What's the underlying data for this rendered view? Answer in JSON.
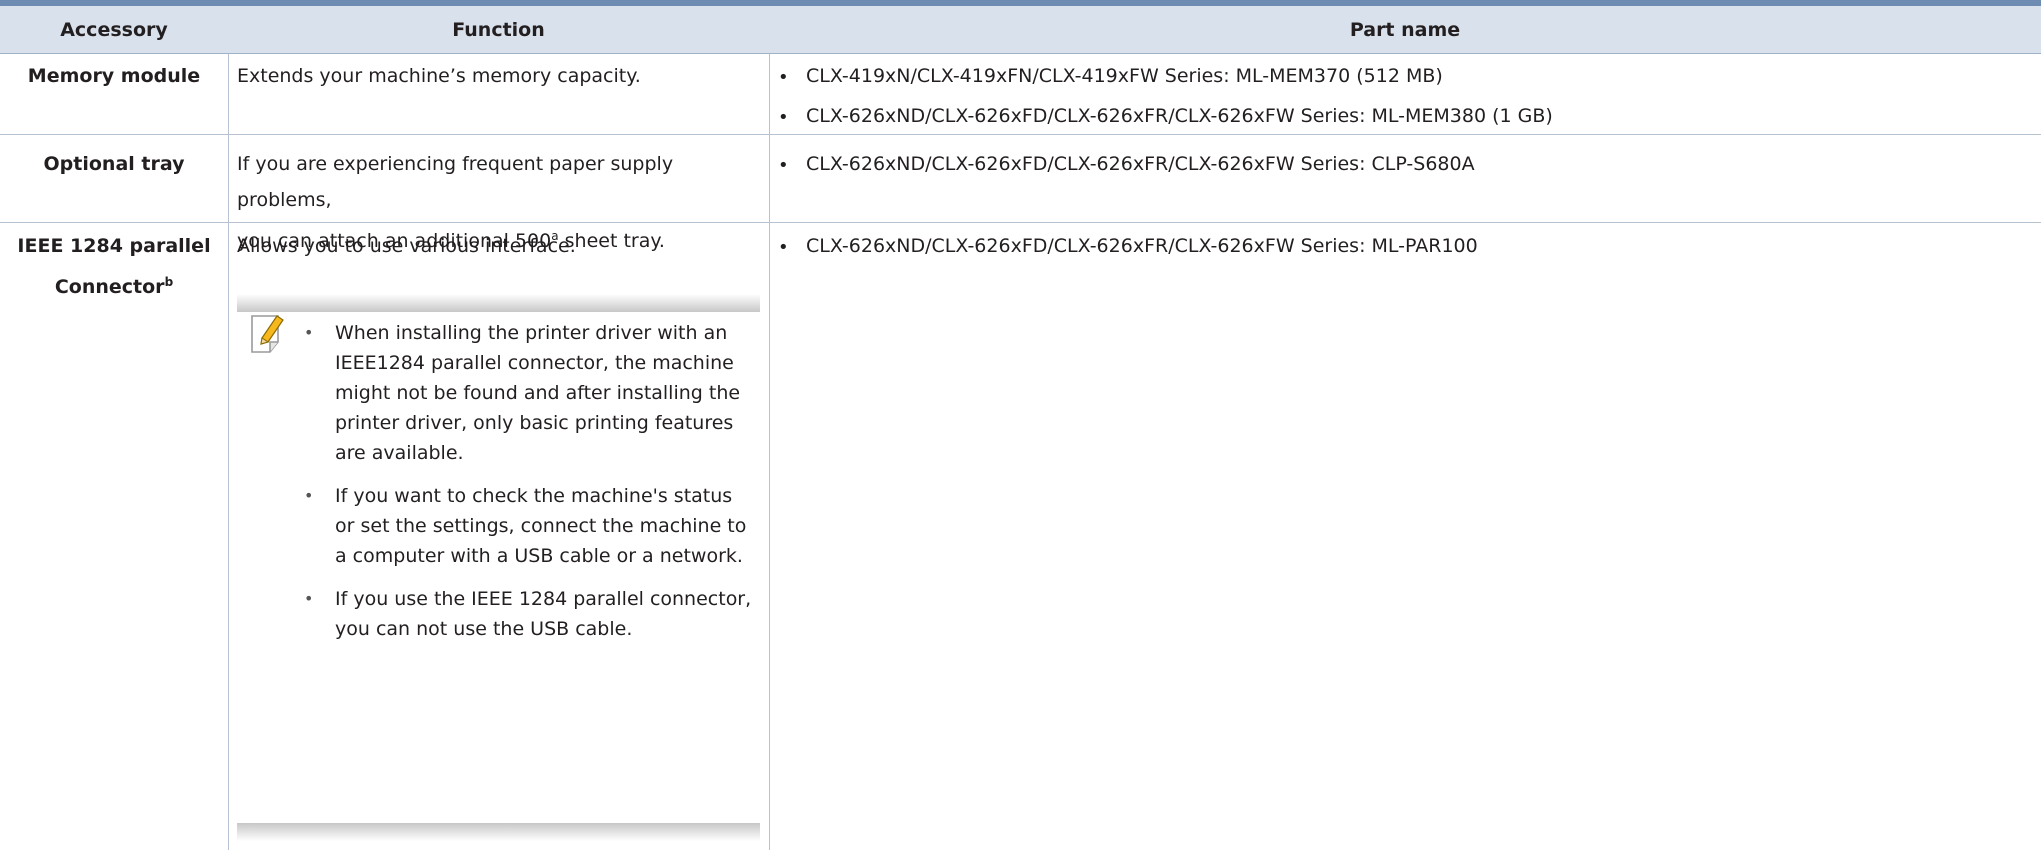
{
  "header": {
    "accessory": "Accessory",
    "function": "Function",
    "part_name": "Part name"
  },
  "rows": [
    {
      "accessory": "Memory module",
      "function": "Extends your machine’s memory capacity.",
      "parts": [
        "CLX-419xN/CLX-419xFN/CLX-419xFW Series: ML-MEM370 (512 MB)",
        "CLX-626xND/CLX-626xFD/CLX-626xFR/CLX-626xFW Series: ML-MEM380 (1 GB)"
      ]
    },
    {
      "accessory": "Optional tray",
      "function_line1": "If you are experiencing frequent paper supply problems,",
      "function_line2_pre": "you can attach an additional 500",
      "function_line2_sup": "a",
      "function_line2_post": " sheet tray.",
      "parts": [
        "CLX-626xND/CLX-626xFD/CLX-626xFR/CLX-626xFW Series: CLP-S680A"
      ]
    },
    {
      "accessory_line1": "IEEE 1284 parallel",
      "accessory_line2": "Connector",
      "accessory_sup": "b",
      "function": "Allows you to use various interface.",
      "parts": [
        "CLX-626xND/CLX-626xFD/CLX-626xFR/CLX-626xFW Series: ML-PAR100"
      ],
      "note": {
        "icon": "note-pencil-icon",
        "items": [
          "When installing the printer driver with an IEEE1284 parallel connector, the machine might not be found and after installing the printer driver, only basic printing features are available.",
          "If you want to check the machine's status or set the settings, connect the machine to a computer with a USB cable or a network.",
          "If you use the IEEE 1284 parallel connector, you can not use the USB cable."
        ]
      }
    }
  ],
  "colors": {
    "header_bg": "#d9e2ec",
    "top_rule": "#6e8bb1",
    "grid": "#b7c3d0"
  }
}
